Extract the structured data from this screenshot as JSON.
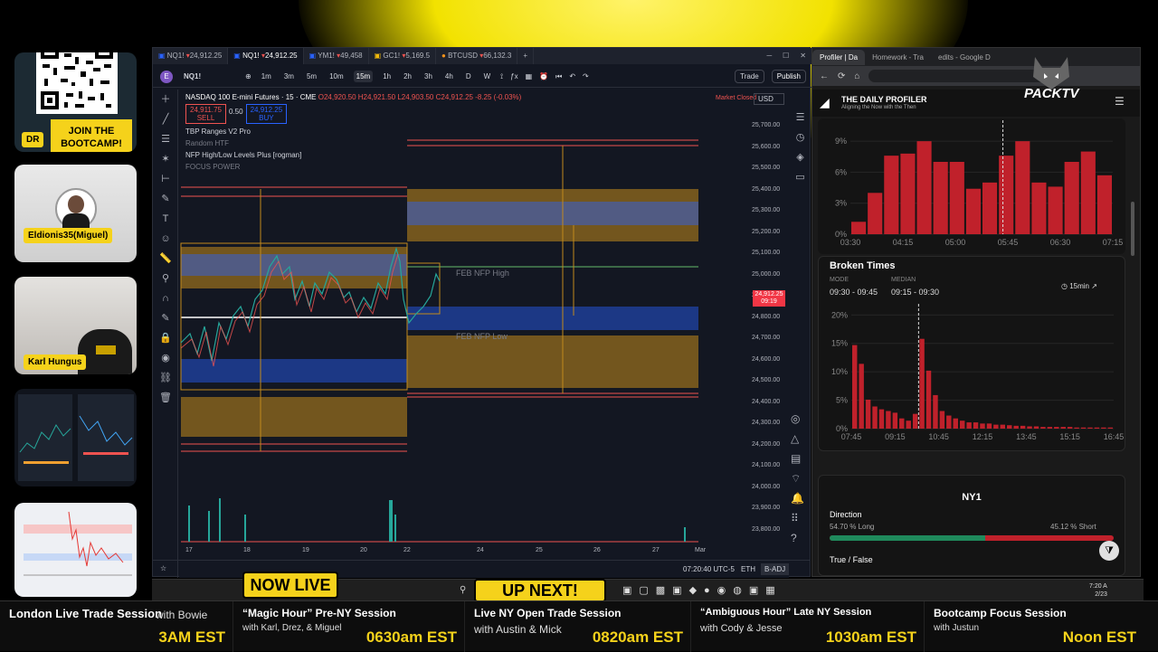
{
  "promo": {
    "join_line1": "JOIN THE",
    "join_line2": "BOOTCAMP!",
    "dr_label": "DR"
  },
  "participants": [
    {
      "name": "Eldionis35(Miguel)"
    },
    {
      "name": "Karl Hungus"
    }
  ],
  "tv": {
    "tabs": [
      {
        "symbol": "NQ1!",
        "price": "24,912.25"
      },
      {
        "symbol": "NQ1!",
        "price": "24,912.25"
      },
      {
        "symbol": "YM1!",
        "price": "49,458"
      },
      {
        "symbol": "GC1!",
        "price": "5,169.5"
      },
      {
        "symbol": "BTCUSD",
        "price": "66,132.3"
      }
    ],
    "symbol_input": "NQ1!",
    "timeframes": [
      "1m",
      "3m",
      "5m",
      "10m",
      "15m",
      "1h",
      "2h",
      "3h",
      "4h",
      "D",
      "W"
    ],
    "active_timeframe": "15m",
    "trade_label": "Trade",
    "publish_label": "Publish",
    "legend": {
      "title": "NASDAQ 100 E-mini Futures · 15 · CME",
      "ohlc": "O24,920.50 H24,921.50 L24,903.50 C24,912.25 -8.25 (-0.03%)",
      "sell_price": "24,911.75",
      "sell_label": "SELL",
      "spread": "0.50",
      "buy_price": "24,912.25",
      "buy_label": "BUY",
      "indicators": [
        "TBP Ranges V2 Pro",
        "Random HTF",
        "NFP High/Low Levels Plus [rogman]",
        "FOCUS POWER"
      ]
    },
    "market_status": "Market Closed",
    "currency": "USD",
    "price_axis": [
      "25,700.00",
      "25,600.00",
      "25,500.00",
      "25,400.00",
      "25,300.00",
      "25,200.00",
      "25,100.00",
      "25,000.00",
      "24,900.00",
      "24,800.00",
      "24,700.00",
      "24,600.00",
      "24,500.00",
      "24,400.00",
      "24,300.00",
      "24,200.00",
      "24,100.00",
      "24,000.00",
      "23,900.00",
      "23,800.00"
    ],
    "last_price": "24,912.25",
    "last_price_time": "09:19",
    "time_axis": [
      "17",
      "18",
      "19",
      "20",
      "22",
      "24",
      "25",
      "26",
      "27",
      "Mar"
    ],
    "chart_labels": {
      "feb_nfp_high": "FEB NFP High",
      "feb_nfp_low": "FEB NFP Low"
    },
    "status_time": "07:20:40 UTC-5",
    "session": "ETH",
    "adj": "B-ADJ"
  },
  "browser": {
    "tabs": [
      "Profiler | Da",
      "Homework - Tra",
      "edits - Google D"
    ],
    "site_title": "THE DAILY PROFILER",
    "site_subtitle": "Aligning the Now with the Then",
    "brand": "PACKTV",
    "chart1": {
      "y_ticks": [
        "9%",
        "6%",
        "3%",
        "0%"
      ],
      "x_ticks": [
        "03:30",
        "04:15",
        "05:00",
        "05:45",
        "06:30",
        "07:15"
      ],
      "values": [
        1.2,
        4,
        7.6,
        7.8,
        9,
        7,
        7,
        4.4,
        5,
        7.6,
        9,
        5,
        4.6,
        7,
        8,
        5.7
      ]
    },
    "broken_times": {
      "title": "Broken Times",
      "mode_label": "MODE",
      "mode": "09:30 - 09:45",
      "median_label": "MEDIAN",
      "median": "09:15 - 09:30",
      "interval": "15min",
      "y_ticks": [
        "20%",
        "15%",
        "10%",
        "5%",
        "0%"
      ],
      "x_ticks": [
        "07:45",
        "09:15",
        "10:45",
        "12:15",
        "13:45",
        "15:15",
        "16:45"
      ],
      "values": [
        14.7,
        11.4,
        5.1,
        3.9,
        3.4,
        3.1,
        2.8,
        1.8,
        1.4,
        2.6,
        15.8,
        10.2,
        5.9,
        3.1,
        2.3,
        1.8,
        1.4,
        1.1,
        1.1,
        0.9,
        0.9,
        0.7,
        0.7,
        0.6,
        0.5,
        0.5,
        0.4,
        0.4,
        0.3,
        0.3,
        0.3,
        0.3,
        0.3,
        0.2,
        0.2,
        0.2,
        0.2,
        0.2,
        0.2
      ]
    },
    "ny1": {
      "title": "NY1",
      "direction_label": "Direction",
      "long_label": "54.70 % Long",
      "short_label": "45.12 % Short",
      "long_pct": 54.7,
      "truefalse_label": "True / False"
    },
    "colors": {
      "bar": "#c0212b",
      "long": "#1f8a5c",
      "short": "#c0212b"
    }
  },
  "ticker": {
    "now_live": "NOW LIVE",
    "up_next": "UP NEXT!",
    "sessions": [
      {
        "title": "London Live Trade Session",
        "host": "with Bowie",
        "time": "3AM EST"
      },
      {
        "title": "“Magic Hour” Pre-NY Session",
        "host": "with Karl, Drez, & Miguel",
        "time": "0630am EST"
      },
      {
        "title": "Live NY Open Trade Session",
        "host": "with Austin & Mick",
        "time": "0820am EST"
      },
      {
        "title": "“Ambiguous Hour” Late NY Session",
        "host": "with Cody & Jesse",
        "time": "1030am EST"
      },
      {
        "title": "Bootcamp Focus Session",
        "host": "with Justun",
        "time": "Noon EST"
      }
    ]
  },
  "taskbar": {
    "clock": "7:20 A",
    "date": "2/23"
  }
}
